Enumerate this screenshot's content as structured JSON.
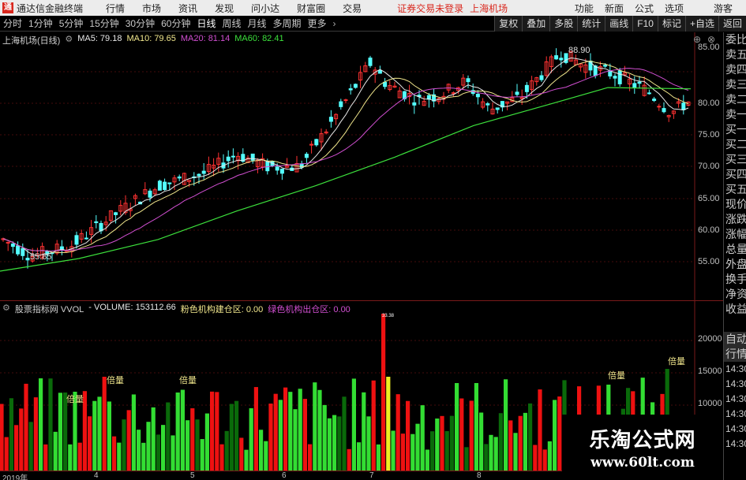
{
  "menubar": {
    "app_name": "通达信金融终端",
    "logo_glyph": "通",
    "menus": [
      "行情",
      "市场",
      "资讯",
      "发现",
      "问小达",
      "财富圈",
      "交易"
    ],
    "status_text": "证券交易未登录",
    "stock_name": "上海机场",
    "right_items": [
      "功能",
      "新面",
      "公式",
      "选项"
    ],
    "guest_label": "游客"
  },
  "periodbar": {
    "periods": [
      "分时",
      "1分钟",
      "5分钟",
      "15分钟",
      "30分钟",
      "60分钟",
      "日线",
      "周线",
      "月线",
      "多周期",
      "更多"
    ],
    "active_period": "日线",
    "tools": [
      "复权",
      "叠加",
      "多股",
      "统计",
      "画线",
      "F10",
      "标记",
      "+自选",
      "返回"
    ]
  },
  "main_chart": {
    "title": "上海机场(日线)",
    "ma_labels": [
      {
        "text": "MA5: 79.18",
        "color": "#e8e8e8"
      },
      {
        "text": "MA10: 79.65",
        "color": "#f0e68c"
      },
      {
        "text": "MA20: 81.14",
        "color": "#d14fd1"
      },
      {
        "text": "MA60: 82.41",
        "color": "#3ce03c"
      }
    ],
    "y_ticks": [
      "85.00",
      "80.00",
      "75.00",
      "70.00",
      "65.00",
      "60.00",
      "55.00"
    ],
    "high_label": "88.90",
    "low_label": "55.85"
  },
  "sub_chart": {
    "title": "股票指标网 VVOL",
    "volume_text": "- VOLUME: 153112.66",
    "pink_label": "粉色机构建仓区: 0.00",
    "green_label": "绿色机构出仓区: 0.00",
    "y_ticks": [
      "20000",
      "15000",
      "10000"
    ],
    "peak_label": "33.38",
    "annotations": [
      "倍量",
      "倍量",
      "倍量",
      "倍量",
      "倍量"
    ]
  },
  "x_axis": {
    "labels": [
      "2019年",
      "4",
      "5",
      "6",
      "7",
      "8"
    ]
  },
  "side_panel": {
    "items": [
      "委比",
      "卖五",
      "卖四",
      "卖三",
      "卖二",
      "卖一",
      "买一",
      "买二",
      "买三",
      "买四",
      "买五",
      "现价",
      "涨跌",
      "涨幅",
      "总量",
      "外盘",
      "换手",
      "净资",
      "收益",
      "",
      "自动",
      "行情",
      "14:30",
      "14:30",
      "14:30",
      "14:30",
      "14:30",
      "14:30"
    ]
  },
  "watermark": {
    "cn_text": "乐淘公式网",
    "url_text": "www.60lt.com"
  },
  "colors": {
    "up": "#ff3232",
    "down": "#54ffff",
    "ma5": "#e8e8e8",
    "ma10": "#f0e68c",
    "ma20": "#d14fd1",
    "ma60": "#3ce03c",
    "vol_green": "#33dd33",
    "vol_red": "#ee1111",
    "vol_yellow": "#eeee22"
  }
}
